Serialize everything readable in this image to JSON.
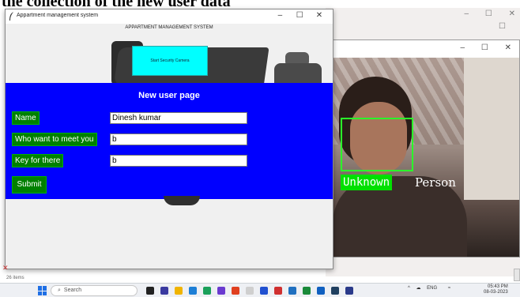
{
  "caption": "the collection of the new user data",
  "app": {
    "window_title": "Appartment management system",
    "header": "APPARTMENT MANAGEMENT SYSTEM",
    "camera_button": "Start Security Camera",
    "controls": {
      "minimize": "–",
      "maximize": "☐",
      "close": "✕"
    }
  },
  "form": {
    "title": "New user page",
    "name_label": "Name",
    "name_value": "Dinesh kumar",
    "meet_label": "Who want to meet you",
    "meet_value": "b",
    "key_label": "Key for there",
    "key_value": "b",
    "submit_label": "Submit"
  },
  "camera_window": {
    "controls": {
      "minimize": "–",
      "maximize": "☐",
      "close": "✕"
    },
    "detection_label_part1": "Unknown",
    "detection_label_part2": "Person"
  },
  "background_window": {
    "controls": {
      "minimize": "–",
      "maximize": "☐",
      "close": "✕"
    },
    "items_count": "26 items"
  },
  "taskbar": {
    "search_placeholder": "Search",
    "tray_lang": "ENG",
    "tray_lang2": "IN",
    "time": "05:43 PM",
    "date": "08-03-2023"
  },
  "colors": {
    "form_background": "#0000ff",
    "label_green": "#008000",
    "camera_button": "#00ffff",
    "face_box": "#2aff2a"
  }
}
